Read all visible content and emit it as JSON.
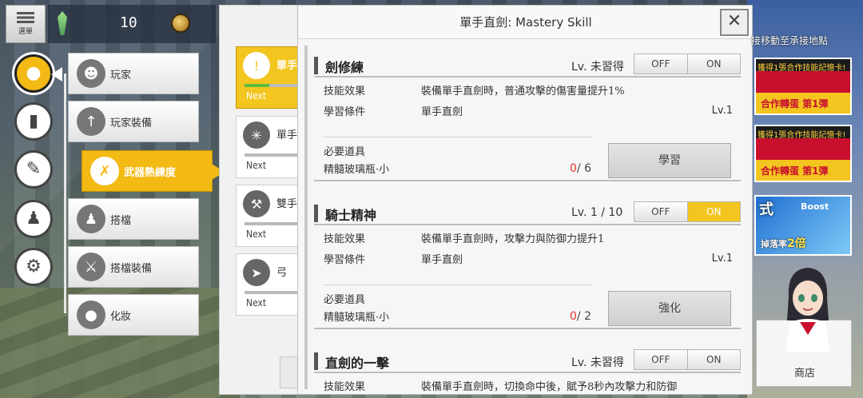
{
  "top": {
    "menu_label": "選單",
    "crystal_count": "10"
  },
  "nav": [
    {
      "name": "player",
      "icon": "person-icon",
      "active": true
    },
    {
      "name": "bag",
      "icon": "bag-icon",
      "active": false
    },
    {
      "name": "quest",
      "icon": "document-icon",
      "active": false
    },
    {
      "name": "friends",
      "icon": "people-icon",
      "active": false
    },
    {
      "name": "settings",
      "icon": "gear-icon",
      "active": false
    }
  ],
  "submenu": [
    {
      "label": "玩家",
      "icon": "player-avatar-icon",
      "active": false
    },
    {
      "label": "玩家裝備",
      "icon": "sword-icon",
      "active": false
    },
    {
      "label": "武器熟練度",
      "icon": "crossed-swords-icon",
      "active": true
    },
    {
      "label": "搭檔",
      "icon": "partner-icon",
      "active": false
    },
    {
      "label": "搭檔裝備",
      "icon": "partner-equip-icon",
      "active": false
    },
    {
      "label": "化妝",
      "icon": "makeup-icon",
      "active": false
    }
  ],
  "weapons": [
    {
      "name": "單手",
      "next": "Next",
      "progress": 0.4,
      "active": true,
      "icon": "one-hand-sword-icon"
    },
    {
      "name": "單手",
      "next": "Next",
      "progress": 0,
      "active": false,
      "icon": "mace-icon"
    },
    {
      "name": "雙手",
      "next": "Next",
      "progress": 0,
      "active": false,
      "icon": "axe-icon"
    },
    {
      "name": "弓",
      "next": "Next",
      "progress": 0,
      "active": false,
      "icon": "bow-icon"
    }
  ],
  "dialog": {
    "title": "單手直劍: Mastery Skill",
    "close": "✕",
    "labels": {
      "effect": "技能效果",
      "condition": "學習條件",
      "required": "必要道具"
    },
    "skills": [
      {
        "name": "劍修練",
        "level": "Lv. 未習得",
        "off": "OFF",
        "on": "ON",
        "on_active": false,
        "effect": "裝備單手直劍時，普通攻擊的傷害量提升1%",
        "condition": "單手直劍",
        "condition_lv": "Lv.1",
        "item": "精髓玻璃瓶·小",
        "item_have": "0",
        "item_need": "/ 6",
        "button": "學習"
      },
      {
        "name": "騎士精神",
        "level": "Lv. 1 / 10",
        "off": "OFF",
        "on": "ON",
        "on_active": true,
        "effect": "裝備單手直劍時，攻擊力與防御力提升1",
        "condition": "單手直劍",
        "condition_lv": "Lv.1",
        "item": "精髓玻璃瓶·小",
        "item_have": "0",
        "item_need": "/ 2",
        "button": "強化"
      },
      {
        "name": "直劍的一擊",
        "level": "Lv. 未習得",
        "off": "OFF",
        "on": "ON",
        "on_active": false,
        "effect": "裝備單手直劍時，切換命中後，賦予8秒內攻擊力和防御"
      }
    ]
  },
  "right": {
    "notice": "接移動至承接地點",
    "banner_top": "獲得1張合作技能記憶卡!",
    "banner_bottom": "合作轉蛋 第1彈",
    "boost_title": "Boost",
    "boost_prefix": "式",
    "boost_text": "掉落率",
    "boost_value": "2倍",
    "shop_label": "商店"
  }
}
